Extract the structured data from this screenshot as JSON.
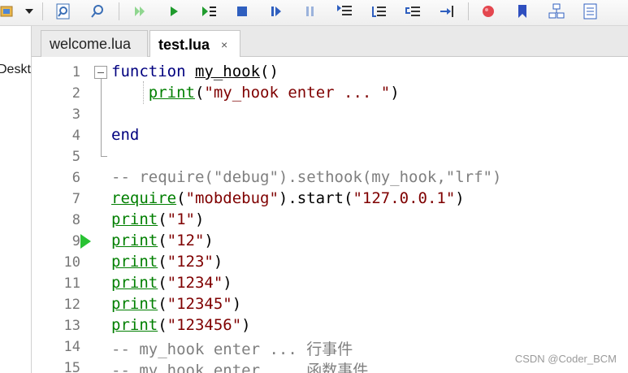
{
  "left_panel": {
    "label": "Deskt"
  },
  "tabs": [
    {
      "label": "welcome.lua",
      "active": false
    },
    {
      "label": "test.lua",
      "active": true,
      "close": "×"
    }
  ],
  "editor": {
    "breakpoint_line": "9",
    "lines": [
      {
        "num": "1",
        "tokens": [
          {
            "t": "function",
            "c": "kw"
          },
          {
            "t": " ",
            "c": ""
          },
          {
            "t": "my_hook",
            "c": "fn"
          },
          {
            "t": "()",
            "c": ""
          }
        ]
      },
      {
        "num": "2",
        "tokens": [
          {
            "t": "    ",
            "c": ""
          },
          {
            "t": "print",
            "c": "bi"
          },
          {
            "t": "(",
            "c": ""
          },
          {
            "t": "\"my_hook enter ... \"",
            "c": "str"
          },
          {
            "t": ")",
            "c": ""
          }
        ]
      },
      {
        "num": "3",
        "tokens": []
      },
      {
        "num": "4",
        "tokens": [
          {
            "t": "end",
            "c": "kw"
          }
        ]
      },
      {
        "num": "5",
        "tokens": []
      },
      {
        "num": "6",
        "tokens": [
          {
            "t": "-- require(\"debug\").sethook(my_hook,\"lrf\")",
            "c": "cm"
          }
        ]
      },
      {
        "num": "7",
        "tokens": [
          {
            "t": "require",
            "c": "bi"
          },
          {
            "t": "(",
            "c": ""
          },
          {
            "t": "\"mobdebug\"",
            "c": "str"
          },
          {
            "t": ").start(",
            "c": ""
          },
          {
            "t": "\"127.0.0.1\"",
            "c": "str"
          },
          {
            "t": ")",
            "c": ""
          }
        ]
      },
      {
        "num": "8",
        "tokens": [
          {
            "t": "print",
            "c": "bi"
          },
          {
            "t": "(",
            "c": ""
          },
          {
            "t": "\"1\"",
            "c": "str"
          },
          {
            "t": ")",
            "c": ""
          }
        ]
      },
      {
        "num": "9",
        "tokens": [
          {
            "t": "print",
            "c": "bi"
          },
          {
            "t": "(",
            "c": ""
          },
          {
            "t": "\"12\"",
            "c": "str"
          },
          {
            "t": ")",
            "c": ""
          }
        ]
      },
      {
        "num": "10",
        "tokens": [
          {
            "t": "print",
            "c": "bi"
          },
          {
            "t": "(",
            "c": ""
          },
          {
            "t": "\"123\"",
            "c": "str"
          },
          {
            "t": ")",
            "c": ""
          }
        ]
      },
      {
        "num": "11",
        "tokens": [
          {
            "t": "print",
            "c": "bi"
          },
          {
            "t": "(",
            "c": ""
          },
          {
            "t": "\"1234\"",
            "c": "str"
          },
          {
            "t": ")",
            "c": ""
          }
        ]
      },
      {
        "num": "12",
        "tokens": [
          {
            "t": "print",
            "c": "bi"
          },
          {
            "t": "(",
            "c": ""
          },
          {
            "t": "\"12345\"",
            "c": "str"
          },
          {
            "t": ")",
            "c": ""
          }
        ]
      },
      {
        "num": "13",
        "tokens": [
          {
            "t": "print",
            "c": "bi"
          },
          {
            "t": "(",
            "c": ""
          },
          {
            "t": "\"123456\"",
            "c": "str"
          },
          {
            "t": ")",
            "c": ""
          }
        ]
      },
      {
        "num": "14",
        "tokens": [
          {
            "t": "-- my_hook enter ... ",
            "c": "cm"
          },
          {
            "t": "行事件",
            "c": "cm cjk"
          }
        ]
      },
      {
        "num": "15",
        "tokens": [
          {
            "t": "-- my_hook enter ... ",
            "c": "cm"
          },
          {
            "t": "函数事件",
            "c": "cm cjk"
          }
        ]
      }
    ]
  },
  "watermark": "CSDN @Coder_BCM",
  "colors": {
    "keyword": "#00007f",
    "builtin": "#007f00",
    "string": "#7f0000",
    "comment": "#7f7f7f",
    "breakpoint": "#29c233"
  }
}
